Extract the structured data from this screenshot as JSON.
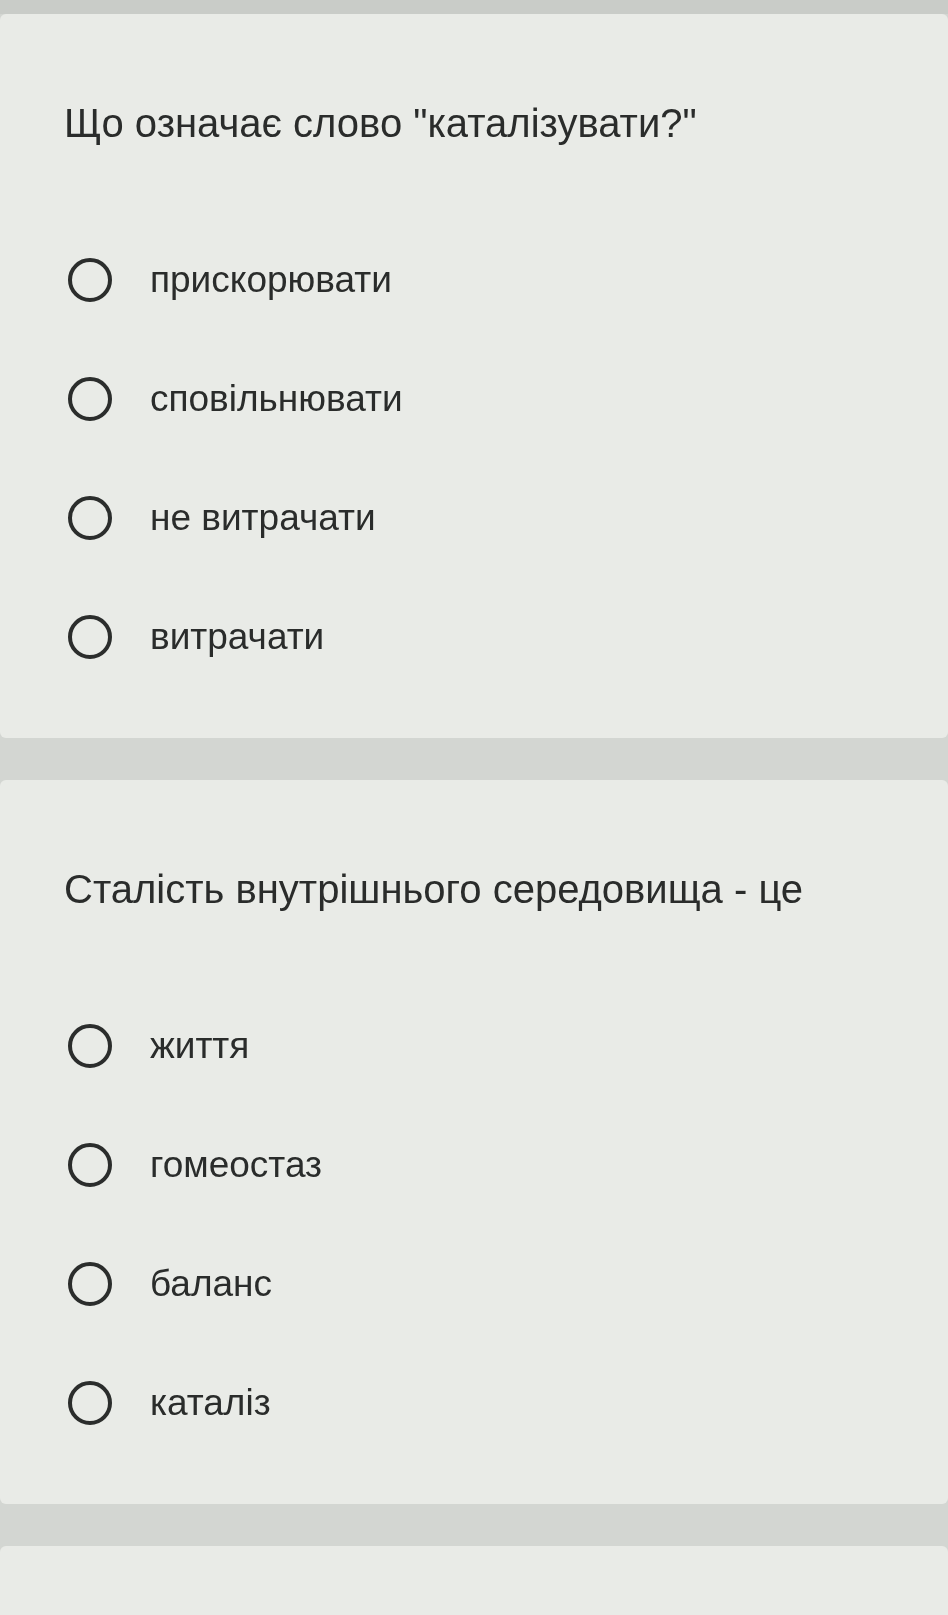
{
  "questions": [
    {
      "text": "Що означає слово \"каталізувати?\"",
      "options": [
        {
          "label": "прискорювати",
          "selected": false
        },
        {
          "label": "сповільнювати",
          "selected": false
        },
        {
          "label": "не витрачати",
          "selected": false
        },
        {
          "label": "витрачати",
          "selected": false
        }
      ]
    },
    {
      "text": "Сталість внутрішнього середовища - це",
      "options": [
        {
          "label": "життя",
          "selected": false
        },
        {
          "label": "гомеостаз",
          "selected": false
        },
        {
          "label": "баланс",
          "selected": false
        },
        {
          "label": "каталіз",
          "selected": false
        }
      ]
    }
  ]
}
